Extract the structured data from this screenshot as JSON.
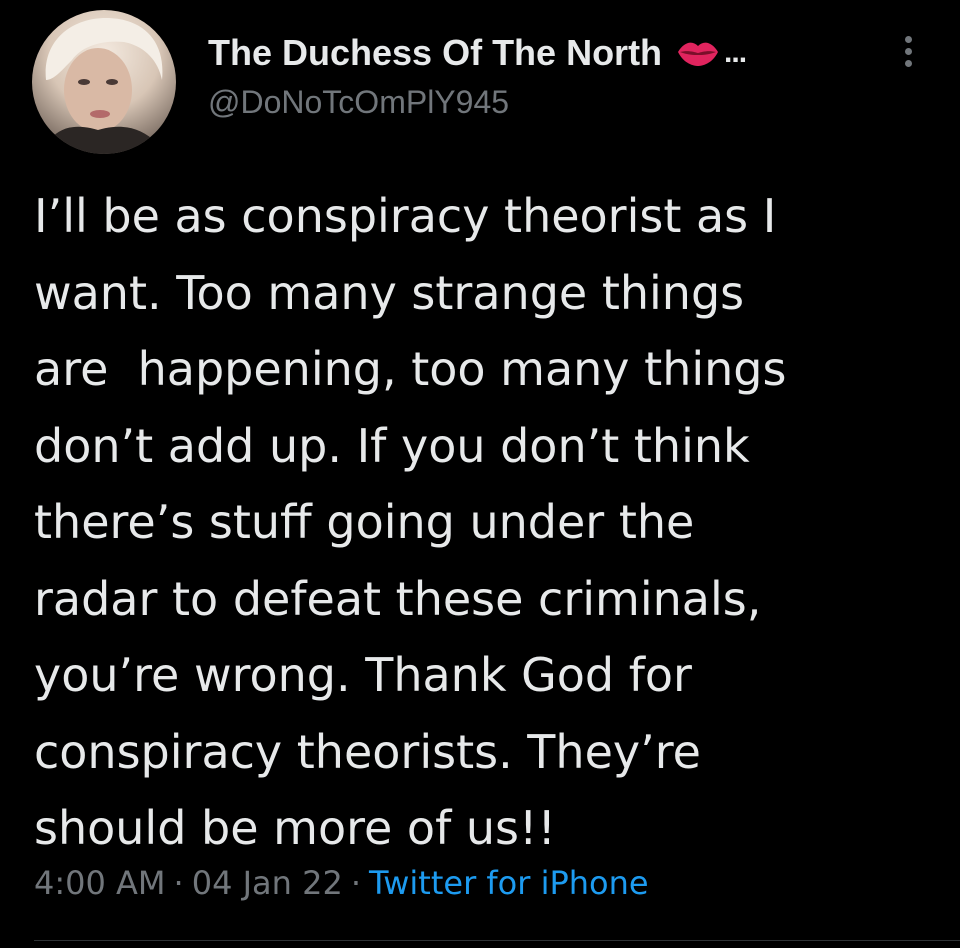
{
  "tweet": {
    "author": {
      "display_name": "The Duchess Of The North",
      "name_emoji": "kiss-lips-icon",
      "truncation": "...",
      "handle": "@DoNoTcOmPlY945"
    },
    "text": "I’ll be as conspiracy theorist as I\nwant. Too many strange things\nare  happening, too many things\ndon’t add up. If you don’t think\nthere’s stuff going under the\nradar to defeat these criminals,\nyou’re wrong. Thank God for\nconspiracy theorists. They’re\nshould be more of us!!",
    "time": "4:00 AM",
    "date": "04 Jan 22",
    "separator": "·",
    "source": "Twitter for iPhone"
  },
  "colors": {
    "background": "#000000",
    "primary_text": "#e7e9ea",
    "secondary_text": "#71767b",
    "link": "#1d9bf0",
    "lips": "#e0245e"
  },
  "icons": [
    "avatar",
    "kiss-lips-icon",
    "more-options-icon"
  ]
}
